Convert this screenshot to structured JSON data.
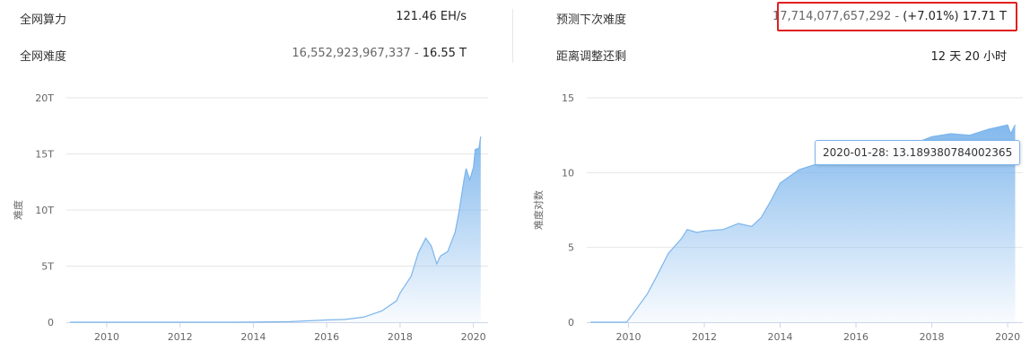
{
  "stats": {
    "hashrate_label": "全网算力",
    "hashrate_value": "121.46 EH/s",
    "difficulty_label": "全网难度",
    "difficulty_number": "16,552,923,967,337",
    "difficulty_sep": " - ",
    "difficulty_short": "16.55 T",
    "predicted_label": "预测下次难度",
    "predicted_number": "17,714,077,657,292",
    "predicted_sep": " - ",
    "predicted_change": "(+7.01%) 17.71 T",
    "remaining_label": "距离调整还剩",
    "remaining_value": "12 天 20 小时"
  },
  "colors": {
    "accent": "#7cb5ec",
    "highlight_box": "#e02020",
    "grid": "#e6e6e6",
    "text": "#333333",
    "axis_text": "#666666"
  },
  "chart_data": [
    {
      "type": "area",
      "ylabel": "难度",
      "xlabel": "",
      "x_ticks": [
        "2010",
        "2012",
        "2014",
        "2016",
        "2018",
        "2020"
      ],
      "y_ticks": [
        "0",
        "5T",
        "10T",
        "15T",
        "20T"
      ],
      "xlim": [
        2008.9,
        2020.4
      ],
      "ylim": [
        0,
        20
      ],
      "x": [
        2009.0,
        2013.0,
        2014.0,
        2015.0,
        2016.0,
        2016.5,
        2017.0,
        2017.5,
        2017.9,
        2018.0,
        2018.3,
        2018.5,
        2018.7,
        2018.85,
        2019.0,
        2019.1,
        2019.3,
        2019.5,
        2019.6,
        2019.75,
        2019.8,
        2019.9,
        2020.0,
        2020.05,
        2020.15,
        2020.2
      ],
      "values": [
        0.0,
        0.0,
        0.01,
        0.05,
        0.2,
        0.25,
        0.45,
        1.0,
        1.9,
        2.6,
        4.1,
        6.2,
        7.5,
        6.8,
        5.2,
        5.9,
        6.3,
        8.0,
        9.7,
        12.8,
        13.7,
        12.7,
        13.8,
        15.4,
        15.5,
        16.55
      ]
    },
    {
      "type": "area",
      "ylabel": "难度对数",
      "xlabel": "",
      "x_ticks": [
        "2010",
        "2012",
        "2014",
        "2016",
        "2018",
        "2020"
      ],
      "y_ticks": [
        "0",
        "5",
        "10",
        "15"
      ],
      "xlim": [
        2008.9,
        2020.4
      ],
      "ylim": [
        0,
        15
      ],
      "x": [
        2009.0,
        2009.95,
        2010.1,
        2010.5,
        2010.75,
        2011.05,
        2011.4,
        2011.55,
        2011.8,
        2012.0,
        2012.5,
        2012.9,
        2013.25,
        2013.5,
        2013.75,
        2014.0,
        2014.5,
        2015.0,
        2015.5,
        2016.0,
        2017.0,
        2017.5,
        2018.0,
        2018.5,
        2019.0,
        2019.5,
        2020.0,
        2020.08,
        2020.2
      ],
      "values": [
        0.0,
        0.0,
        0.5,
        1.9,
        3.1,
        4.6,
        5.6,
        6.2,
        6.0,
        6.1,
        6.2,
        6.6,
        6.4,
        7.0,
        8.1,
        9.3,
        10.2,
        10.6,
        10.7,
        11.1,
        11.6,
        11.9,
        12.4,
        12.6,
        12.5,
        12.9,
        13.19,
        12.6,
        13.2
      ]
    }
  ],
  "tooltip": {
    "text": "2020-01-28: 13.189380784002365"
  }
}
